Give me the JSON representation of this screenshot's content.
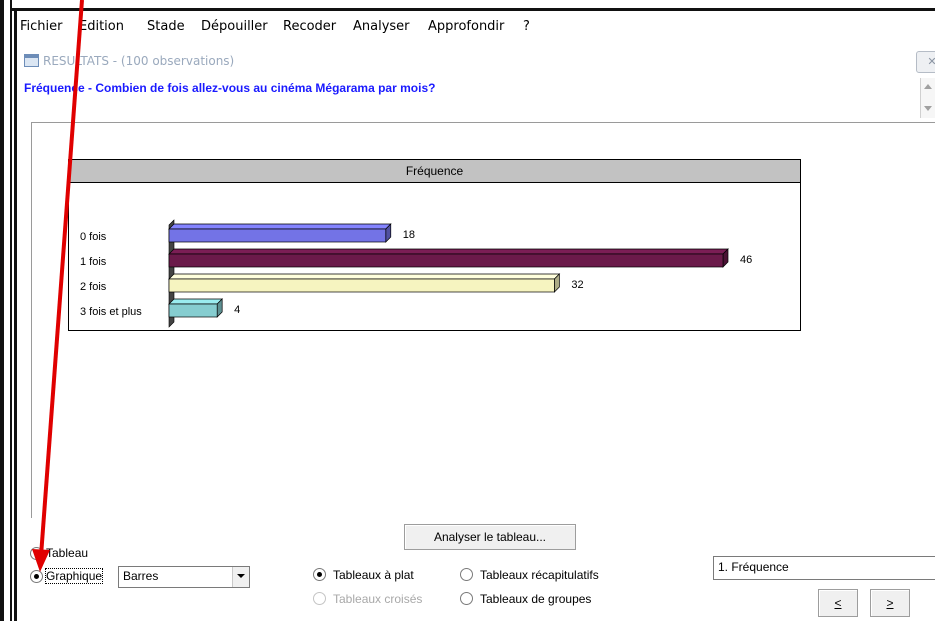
{
  "menu": [
    "Fichier",
    "Edition",
    "Stade",
    "Dépouiller",
    "Recoder",
    "Analyser",
    "Approfondir",
    "?"
  ],
  "window": {
    "title": "RESULTATS - (100 observations)",
    "close_glyph": "✕"
  },
  "question_title": "Fréquence - Combien de fois allez-vous au cinéma Mégarama par mois?",
  "chart_data": {
    "type": "bar",
    "orientation": "horizontal",
    "title": "Fréquence",
    "categories": [
      "0 fois",
      "1 fois",
      "2 fois",
      "3 fois et plus"
    ],
    "values": [
      18,
      46,
      32,
      4
    ],
    "colors": [
      "#7373e6",
      "#6b1a4a",
      "#f6f4c0",
      "#86cdd0"
    ],
    "xlim": [
      0,
      46
    ],
    "grid": false,
    "legend": "none"
  },
  "controls": {
    "analyze_button": "Analyser le tableau...",
    "view_mode": {
      "tableau": "Tableau",
      "graphique": "Graphique",
      "selected": "graphique"
    },
    "graph_type": "Barres",
    "table_types": {
      "a_plat": "Tableaux à plat",
      "croises": "Tableaux croisés",
      "recapitulatifs": "Tableaux récapitulatifs",
      "groupes": "Tableaux de groupes",
      "selected": "a_plat"
    },
    "table_select": "1. Fréquence",
    "prev_button": "<",
    "next_button": ">"
  },
  "annotation_color": "#e00000"
}
